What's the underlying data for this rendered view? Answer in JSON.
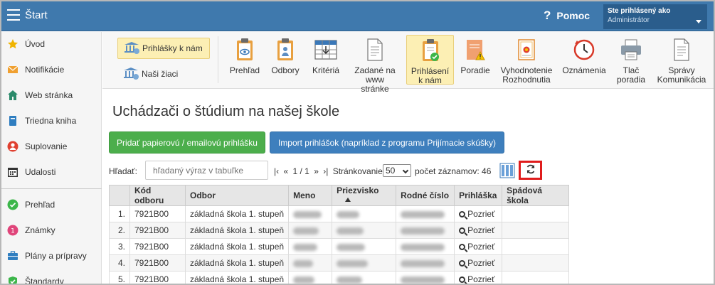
{
  "topbar": {
    "title": "Štart",
    "help_label": "Pomoc",
    "user_line1": "Ste prihlásený ako",
    "user_line2": "Administrátor"
  },
  "sidebar": {
    "items": [
      {
        "label": "Úvod",
        "icon": "star-icon"
      },
      {
        "label": "Notifikácie",
        "icon": "envelope-icon"
      },
      {
        "label": "Web stránka",
        "icon": "home-icon"
      },
      {
        "label": "Triedna kniha",
        "icon": "book-icon"
      },
      {
        "label": "Suplovanie",
        "icon": "person-icon"
      },
      {
        "label": "Udalosti",
        "icon": "calendar-icon"
      },
      {
        "label": "Prehľad",
        "icon": "check-circle-icon"
      },
      {
        "label": "Známky",
        "icon": "grade-icon"
      },
      {
        "label": "Plány a prípravy",
        "icon": "briefcase-icon"
      },
      {
        "label": "Štandardy",
        "icon": "shield-check-icon"
      }
    ]
  },
  "toolbar": {
    "left": [
      {
        "label": "Prihlášky k nám",
        "active": true
      },
      {
        "label": "Naši žiaci",
        "active": false
      }
    ],
    "buttons": [
      {
        "label": "Prehľad",
        "icon": "clipboard-eye-icon"
      },
      {
        "label": "Odbory",
        "icon": "clipboard-person-icon"
      },
      {
        "label": "Kritériá",
        "icon": "grid-table-icon"
      },
      {
        "label": "Zadané na www stránke",
        "icon": "document-icon"
      },
      {
        "label": "Prihlásení k nám",
        "icon": "clipboard-check-icon",
        "active": true
      },
      {
        "label": "Poradie",
        "icon": "warning-doc-icon"
      },
      {
        "label": "Vyhodnotenie Rozhodnutia",
        "icon": "certificate-icon"
      },
      {
        "label": "Oznámenia",
        "icon": "clock-icon"
      },
      {
        "label": "Tlač poradia",
        "icon": "printer-icon"
      },
      {
        "label": "Správy Komunikácia",
        "icon": "report-doc-icon"
      }
    ]
  },
  "main": {
    "title": "Uchádzači o štúdium na našej škole",
    "btn_add": "Pridať papierovú / emailovú prihlášku",
    "btn_import": "Import prihlášok (napríklad z programu Prijímacie skúšky)",
    "filter_label": "Hľadať:",
    "search_placeholder": "hľadaný výraz v tabuľke",
    "pager_text": "1 / 1",
    "page_size_label": "Stránkovanie:",
    "page_size": "50",
    "records_label": "počet záznamov: 46"
  },
  "table": {
    "headers": [
      "",
      "Kód odboru",
      "Odbor",
      "Meno",
      "Priezvisko",
      "Rodné číslo",
      "Prihláška",
      "Spádová škola"
    ],
    "rows": [
      {
        "n": "1.",
        "kod": "7921B00",
        "odbor": "základná škola 1. stupeň",
        "link": "Pozrieť"
      },
      {
        "n": "2.",
        "kod": "7921B00",
        "odbor": "základná škola 1. stupeň",
        "link": "Pozrieť"
      },
      {
        "n": "3.",
        "kod": "7921B00",
        "odbor": "základná škola 1. stupeň",
        "link": "Pozrieť"
      },
      {
        "n": "4.",
        "kod": "7921B00",
        "odbor": "základná škola 1. stupeň",
        "link": "Pozrieť"
      },
      {
        "n": "5.",
        "kod": "7921B00",
        "odbor": "základná škola 1. stupeň",
        "link": "Pozrieť"
      }
    ]
  }
}
